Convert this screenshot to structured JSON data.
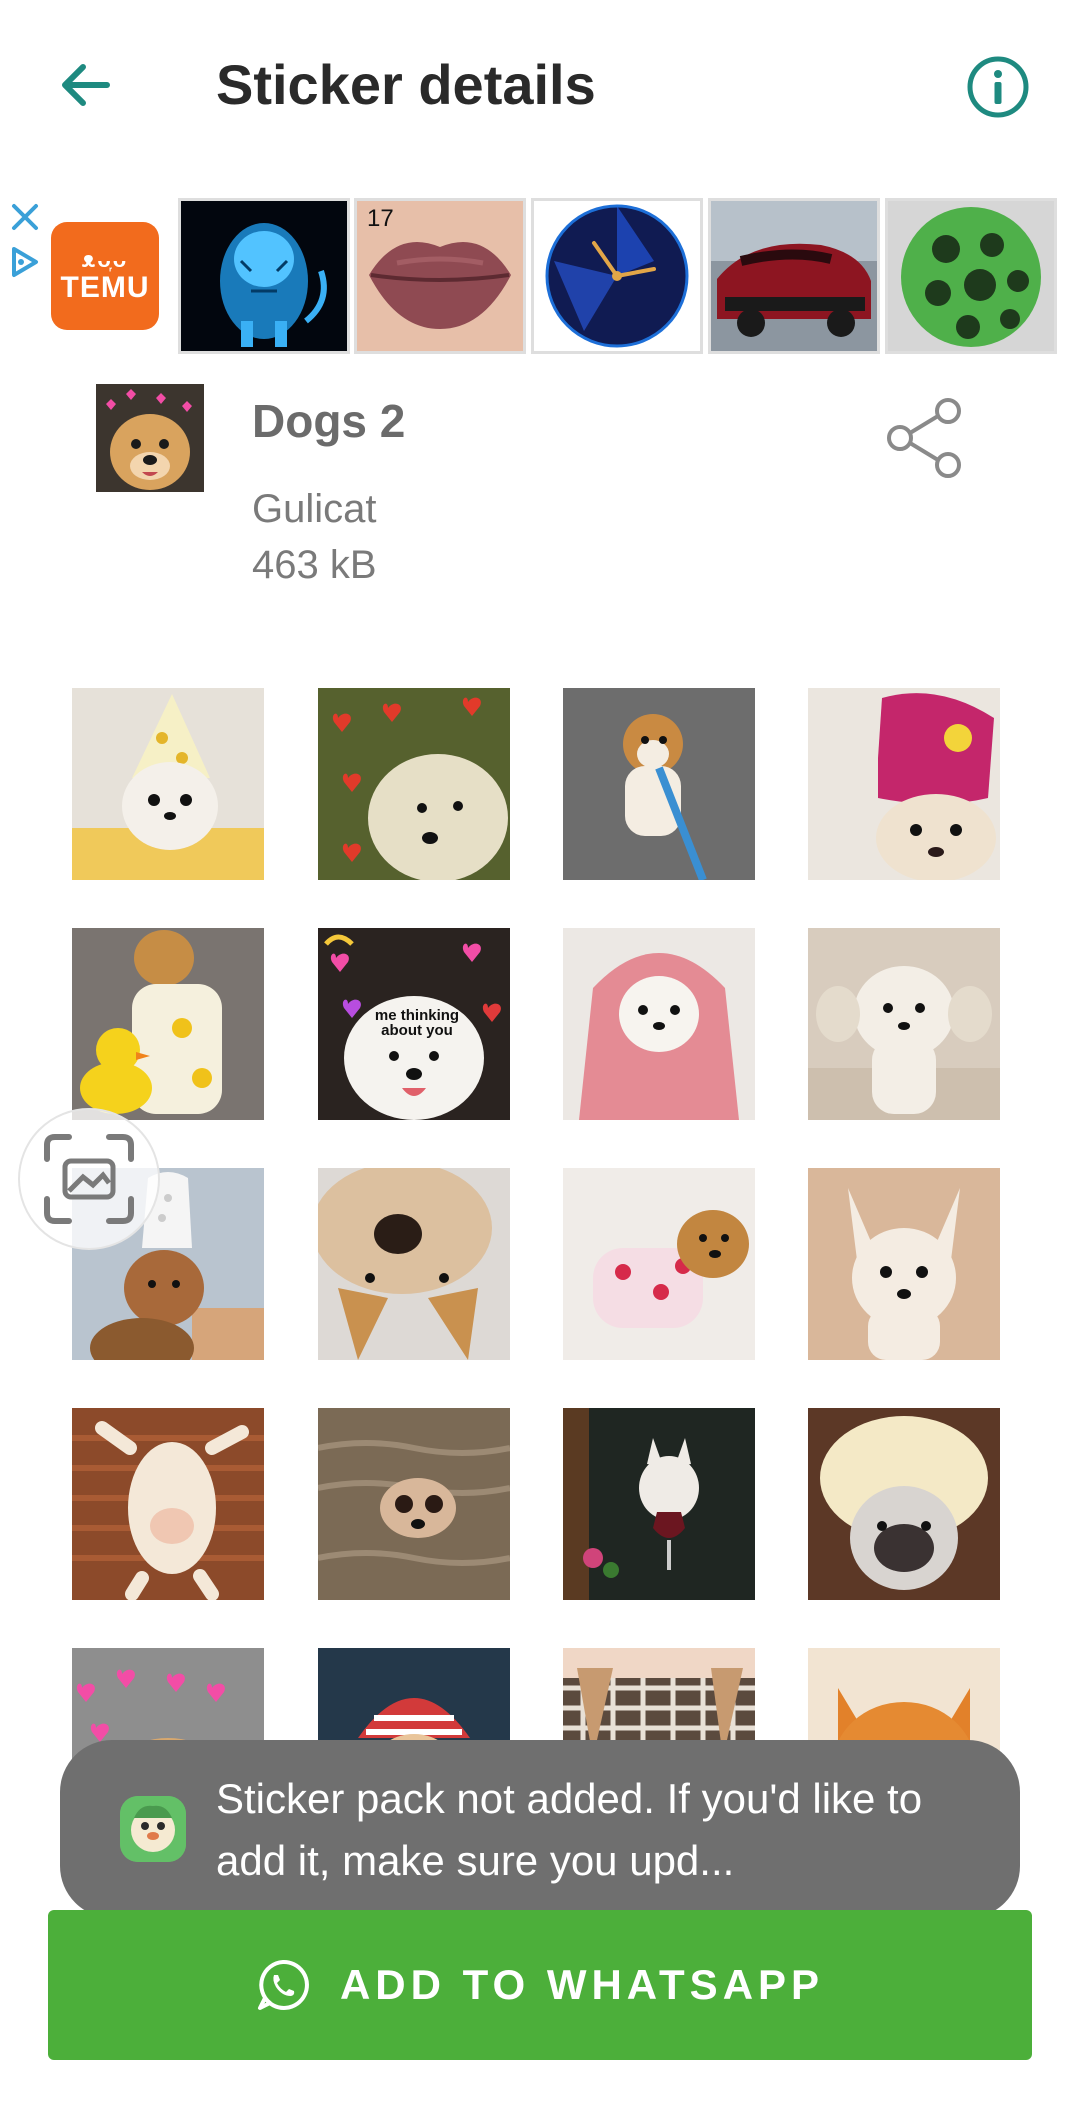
{
  "toolbar": {
    "title": "Sticker details",
    "back_icon": "arrow-left-icon",
    "info_icon": "info-circle-icon",
    "accent_color": "#1e8a80"
  },
  "ad": {
    "brand_glyphs": "ᴥᴗ᷊ᴗ",
    "brand_name": "TEMU",
    "brand_color": "#f26b1d",
    "tile_17_label": "17",
    "close_icon": "close-icon",
    "adchoices_icon": "adchoices-icon"
  },
  "pack": {
    "title": "Dogs 2",
    "author": "Gulicat",
    "size": "463 kB",
    "share_icon": "share-icon"
  },
  "stickers": {
    "caption_me_thinking": "me thinking\nabout you"
  },
  "toast": {
    "message": "Sticker pack not added. If you'd like to add it, make sure you upd..."
  },
  "add_button": {
    "label": "ADD TO WHATSAPP",
    "color": "#4caf3a",
    "icon": "whatsapp-icon"
  }
}
